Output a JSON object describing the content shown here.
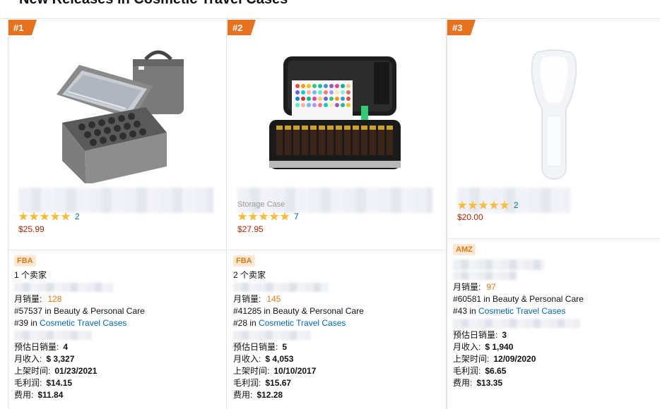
{
  "page": {
    "title": "New Releases in Cosmetic Travel Cases"
  },
  "products": [
    {
      "rank": "#1",
      "title_peek": "",
      "rating_count": "2",
      "price": "$25.99",
      "tag": "FBA",
      "sellers": "1 个卖家",
      "monthly_sales_label": "月销量:",
      "monthly_sales": "128",
      "rank_main": "#57537 in Beauty & Personal Care",
      "rank_sub_prefix": "#39 in ",
      "rank_sub_link": "Cosmetic Travel Cases",
      "est_daily_label": "预估日销量:",
      "est_daily": "4",
      "monthly_revenue_label": "月收入:",
      "monthly_revenue": "$ 3,327",
      "listed_label": "上架时间:",
      "listed": "01/23/2021",
      "gross_profit_label": "毛利润:",
      "gross_profit": "$14.15",
      "fees_label": "费用:",
      "fees": "$11.84"
    },
    {
      "rank": "#2",
      "title_peek": "Storage Case",
      "rating_count": "7",
      "price": "$27.95",
      "tag": "FBA",
      "sellers": "2 个卖家",
      "monthly_sales_label": "月销量:",
      "monthly_sales": "145",
      "rank_main": "#41285 in Beauty & Personal Care",
      "rank_sub_prefix": "#28 in ",
      "rank_sub_link": "Cosmetic Travel Cases",
      "est_daily_label": "预估日销量:",
      "est_daily": "5",
      "monthly_revenue_label": "月收入:",
      "monthly_revenue": "$ 4,053",
      "listed_label": "上架时间:",
      "listed": "10/10/2017",
      "gross_profit_label": "毛利润:",
      "gross_profit": "$15.67",
      "fees_label": "费用:",
      "fees": "$12.28"
    },
    {
      "rank": "#3",
      "title_peek": "",
      "rating_count": "2",
      "price": "$20.00",
      "tag": "AMZ",
      "sellers": "",
      "monthly_sales_label": "月销量:",
      "monthly_sales": "97",
      "rank_main": "#60581 in Beauty & Personal Care",
      "rank_sub_prefix": "#43 in ",
      "rank_sub_link": "Cosmetic Travel Cases",
      "est_daily_label": "预估日销量:",
      "est_daily": "3",
      "monthly_revenue_label": "月收入:",
      "monthly_revenue": "$ 1,940",
      "listed_label": "上架时间:",
      "listed": "12/09/2020",
      "gross_profit_label": "毛利润:",
      "gross_profit": "$6.65",
      "fees_label": "费用:",
      "fees": "$13.35"
    }
  ],
  "colors": {
    "accent": "#e8711e",
    "link": "#0066c0",
    "price": "#b12704",
    "star": "#f2a92d"
  }
}
